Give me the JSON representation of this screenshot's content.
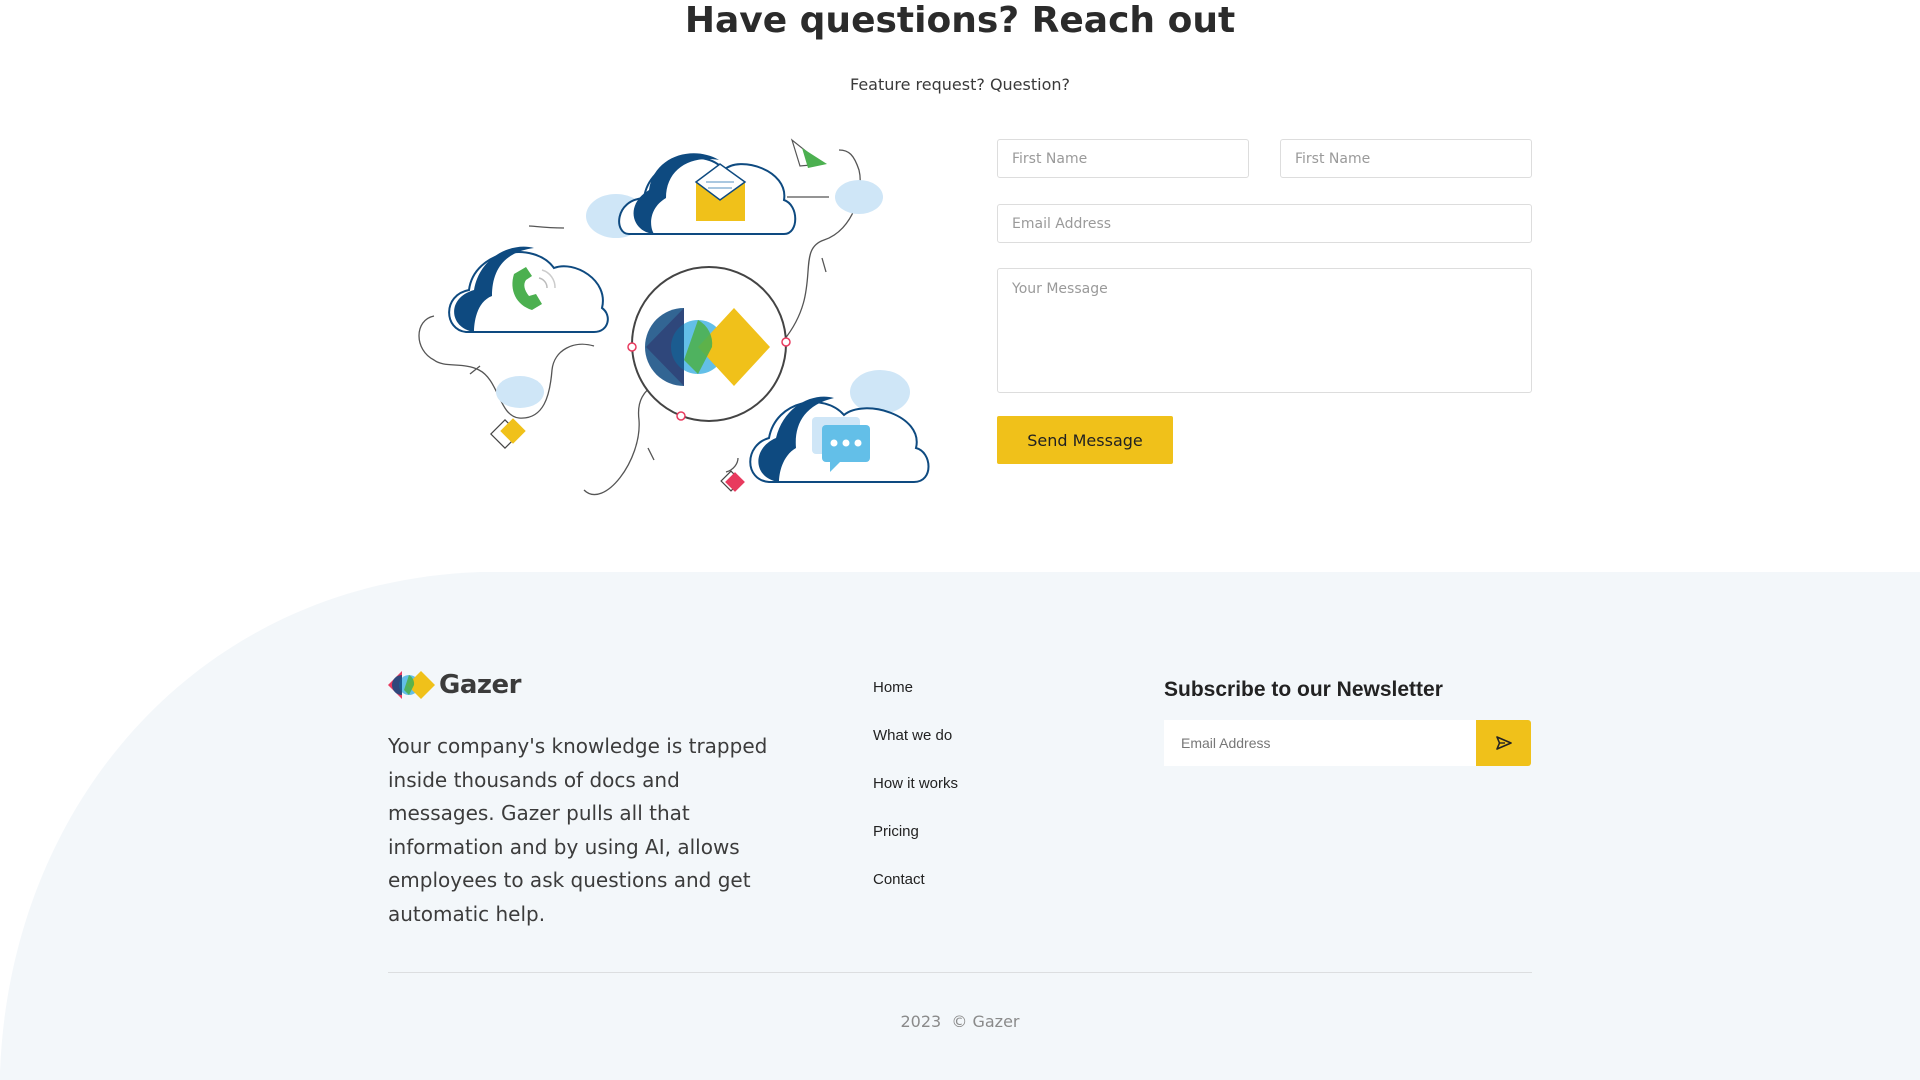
{
  "contact": {
    "title": "Have questions? Reach out",
    "subtitle": "Feature request? Question?",
    "form": {
      "first_name_placeholder": "First Name",
      "second_name_placeholder": "First Name",
      "email_placeholder": "Email Address",
      "message_placeholder": "Your Message",
      "send_label": "Send Message"
    }
  },
  "footer": {
    "brand_name": "Gazer",
    "description": "Your company's knowledge is trapped inside thousands of docs and messages. Gazer pulls all that information and by using AI, allows employees to ask questions and get automatic help.",
    "nav": [
      {
        "label": "Home"
      },
      {
        "label": "What we do"
      },
      {
        "label": "How it works"
      },
      {
        "label": "Pricing"
      },
      {
        "label": "Contact"
      }
    ],
    "newsletter": {
      "title": "Subscribe to our Newsletter",
      "email_placeholder": "Email Address",
      "submit_icon": "send-arrow-icon"
    },
    "copyright_year": "2023",
    "copyright_text": "© Gazer"
  },
  "colors": {
    "accent": "#f0c11a",
    "footer_bg": "#f3f7fa",
    "brand_red": "#e83a5e",
    "brand_blue": "#63bfe8",
    "brand_green": "#4cb050",
    "cloud_dark": "#0e4a80"
  }
}
